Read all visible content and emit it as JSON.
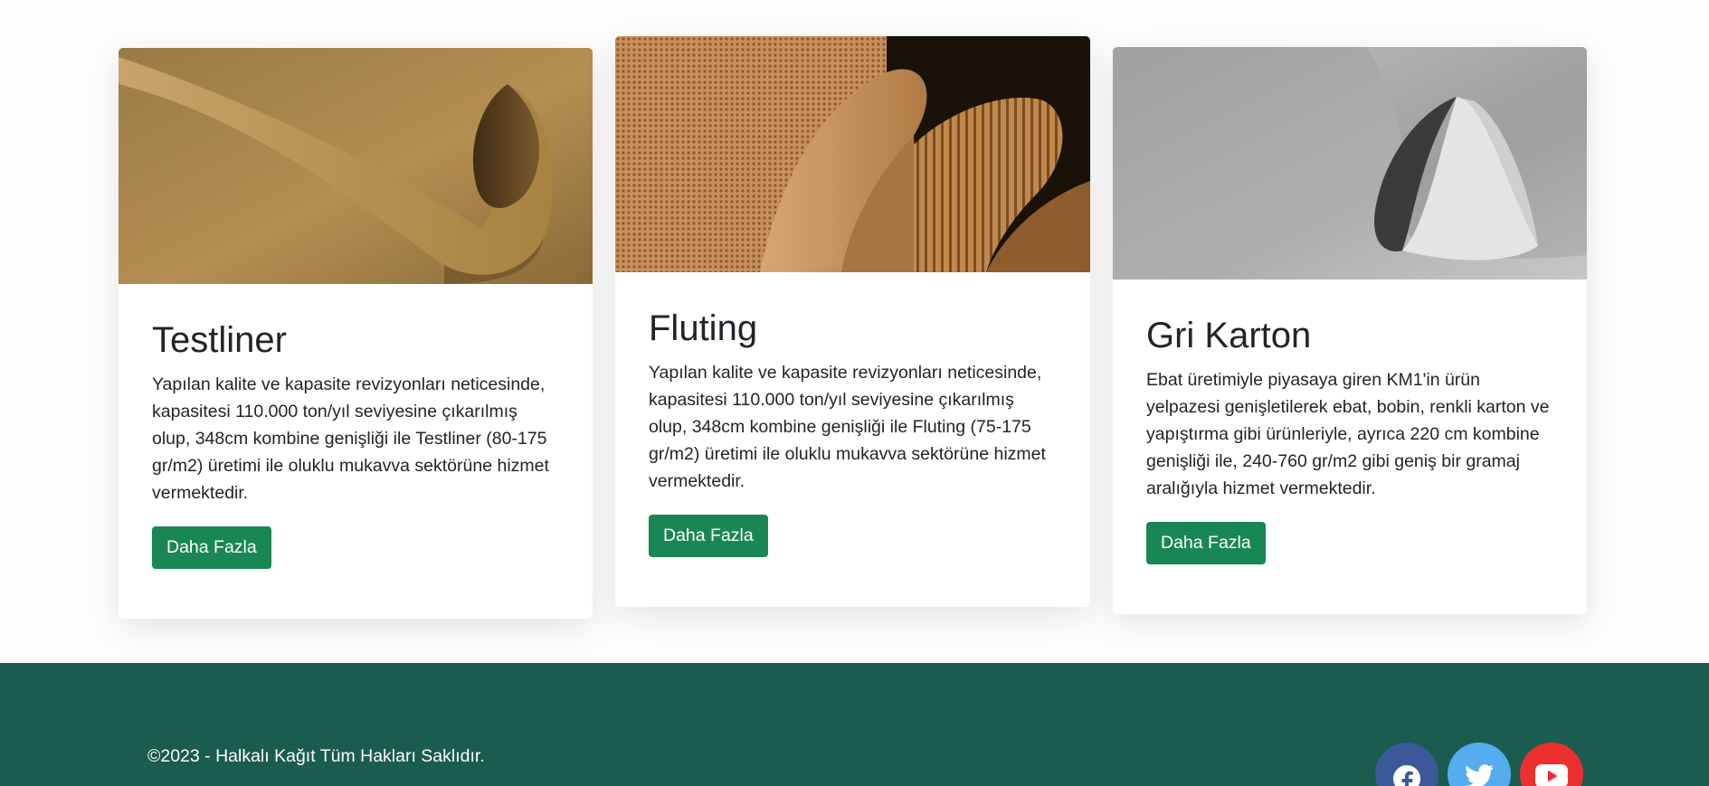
{
  "cards": [
    {
      "title": "Testliner",
      "text": "Yapılan kalite ve kapasite revizyonları neticesinde, kapasitesi 110.000 ton/yıl seviyesine çıkarılmış olup, 348cm kombine genişliği ile Testliner (80-175 gr/m2) üretimi ile oluklu mukavva sektörüne hizmet vermektedir.",
      "button": "Daha Fazla"
    },
    {
      "title": "Fluting",
      "text": "Yapılan kalite ve kapasite revizyonları neticesinde, kapasitesi 110.000 ton/yıl seviyesine çıkarılmış olup, 348cm kombine genişliği ile Fluting (75-175 gr/m2) üretimi ile oluklu mukavva sektörüne hizmet vermektedir.",
      "button": "Daha Fazla"
    },
    {
      "title": "Gri Karton",
      "text": "Ebat üretimiyle piyasaya giren KM1'in ürün yelpazesi genişletilerek ebat, bobin, renkli karton ve yapıştırma gibi ürünleriyle, ayrıca 220 cm kombine genişliği ile, 240-760 gr/m2 gibi geniş bir gramaj aralığıyla hizmet vermektedir.",
      "button": "Daha Fazla"
    }
  ],
  "footer": {
    "copyright": "©2023 - Halkalı Kağıt Tüm Hakları Saklıdır.",
    "social": [
      {
        "icon": "facebook-icon",
        "color": "#3b5998"
      },
      {
        "icon": "twitter-icon",
        "color": "#55acee"
      },
      {
        "icon": "youtube-icon",
        "color": "#ed302f"
      }
    ]
  },
  "colors": {
    "button": "#198754",
    "footer": "#1a5c4e",
    "card": "#ffffff"
  }
}
